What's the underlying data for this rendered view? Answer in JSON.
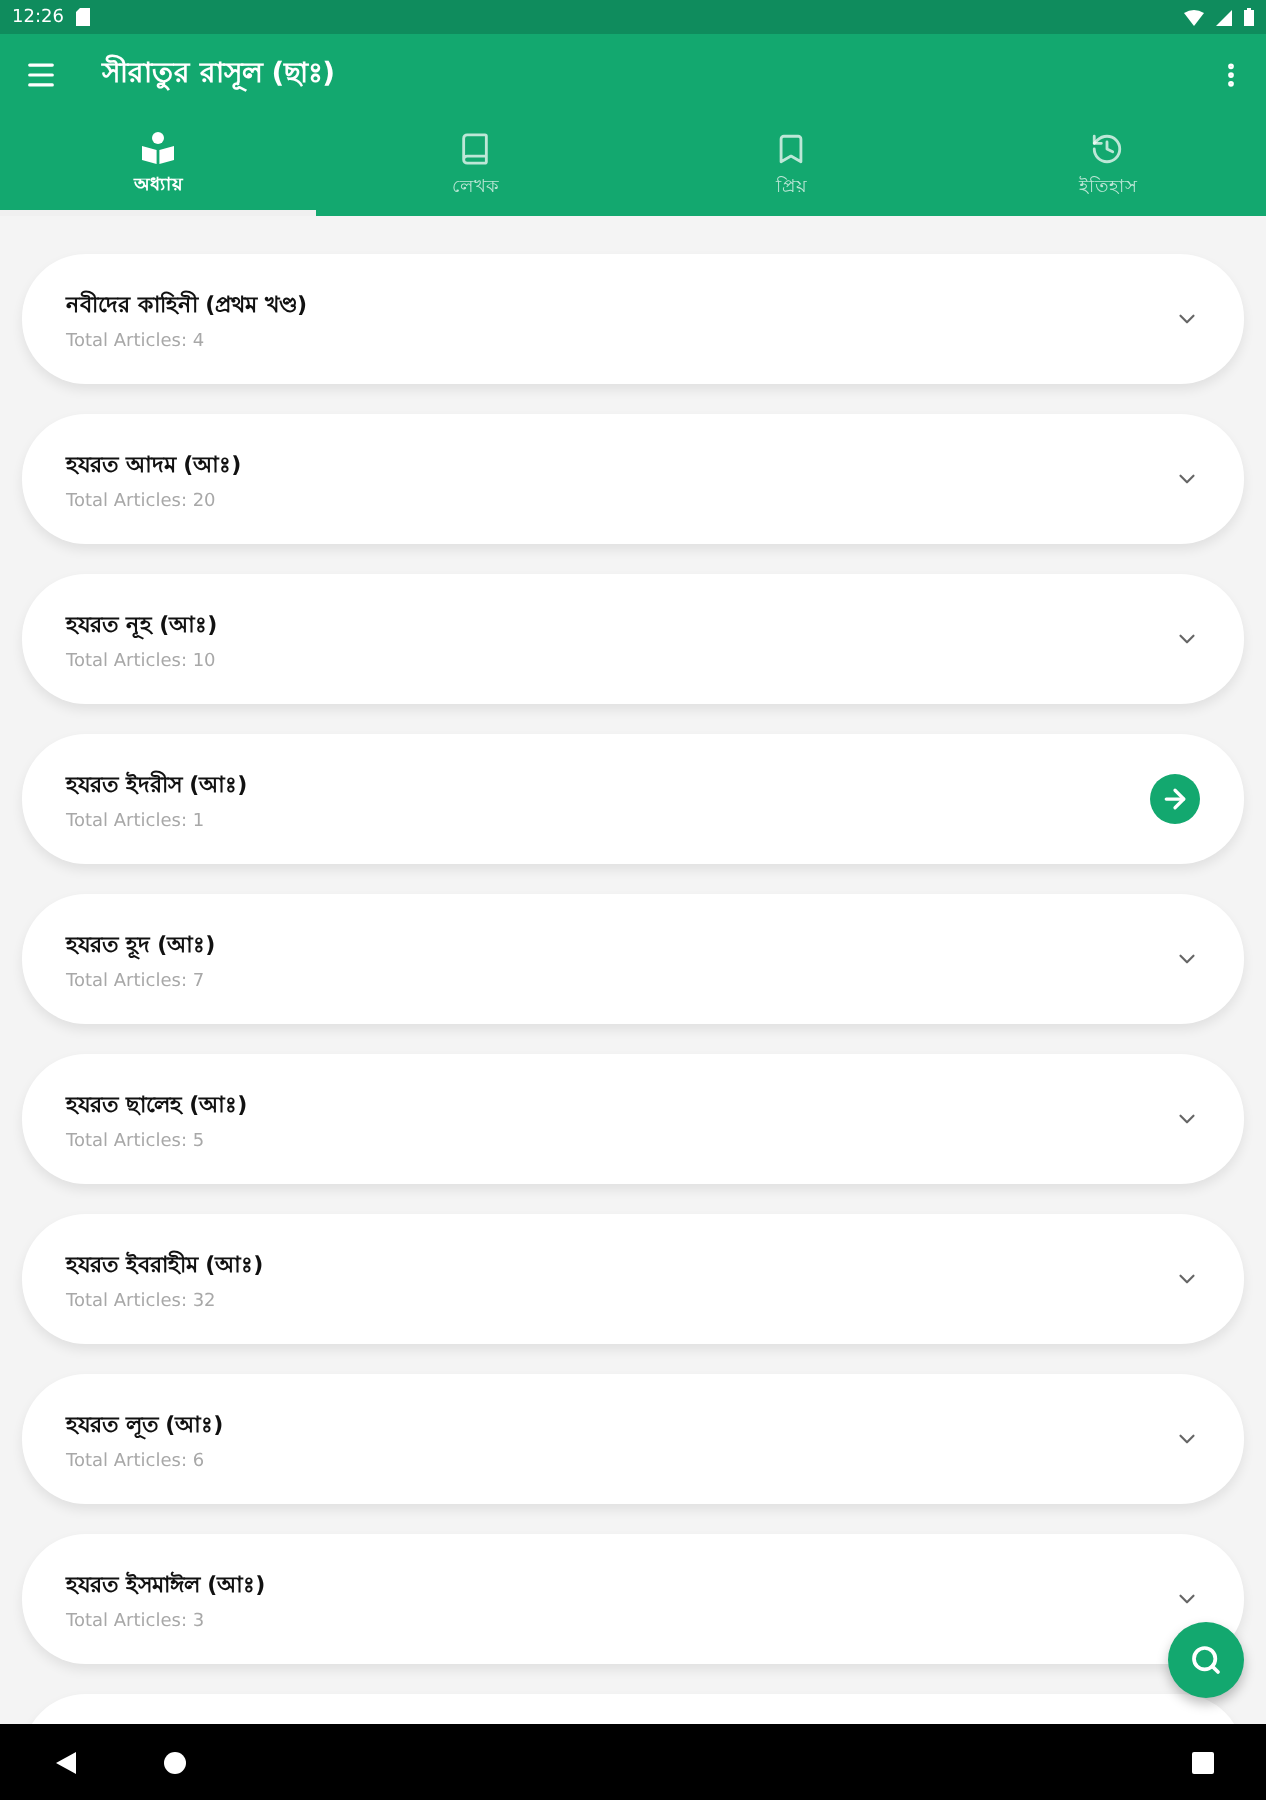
{
  "status_bar": {
    "time": "12:26"
  },
  "app_bar": {
    "title": "সীরাতুর রাসূল (ছাঃ)"
  },
  "tabs": [
    {
      "label": "অধ্যায়",
      "selected": true
    },
    {
      "label": "লেখক",
      "selected": false
    },
    {
      "label": "প্রিয়",
      "selected": false
    },
    {
      "label": "ইতিহাস",
      "selected": false
    }
  ],
  "chapters": [
    {
      "title": "নবীদের কাহিনী (প্রথম খণ্ড)",
      "subtitle": "Total Articles: 4",
      "kind": "expandable"
    },
    {
      "title": "হযরত আদম (আঃ)",
      "subtitle": "Total Articles: 20",
      "kind": "expandable"
    },
    {
      "title": "হযরত নূহ (আঃ)",
      "subtitle": "Total Articles: 10",
      "kind": "expandable"
    },
    {
      "title": "হযরত ইদরীস (আঃ)",
      "subtitle": "Total Articles: 1",
      "kind": "link"
    },
    {
      "title": "হযরত হূদ (আঃ)",
      "subtitle": "Total Articles: 7",
      "kind": "expandable"
    },
    {
      "title": "হযরত ছালেহ (আঃ)",
      "subtitle": "Total Articles: 5",
      "kind": "expandable"
    },
    {
      "title": "হযরত ইবরাহীম (আঃ)",
      "subtitle": "Total Articles: 32",
      "kind": "expandable"
    },
    {
      "title": "হযরত লূত (আঃ)",
      "subtitle": "Total Articles: 6",
      "kind": "expandable"
    },
    {
      "title": "হযরত ইসমাঈল (আঃ)",
      "subtitle": "Total Articles: 3",
      "kind": "expandable"
    }
  ]
}
